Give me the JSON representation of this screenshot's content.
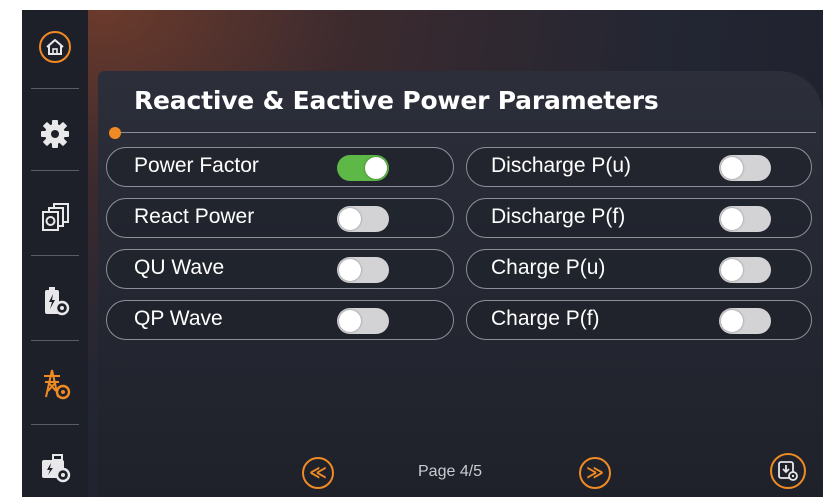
{
  "title": "Reactive & Eactive Power Parameters",
  "colors": {
    "accent": "#f08a24",
    "toggle_on": "#5db847",
    "toggle_off": "#d3d3d6"
  },
  "sidebar": {
    "items": [
      {
        "name": "home",
        "icon": "home-icon",
        "active": false
      },
      {
        "name": "settings",
        "icon": "gear-icon",
        "active": false
      },
      {
        "name": "devices",
        "icon": "device-stack-icon",
        "active": false
      },
      {
        "name": "battery",
        "icon": "battery-settings-icon",
        "active": false
      },
      {
        "name": "grid",
        "icon": "grid-tower-settings-icon",
        "active": true
      },
      {
        "name": "generator",
        "icon": "generator-settings-icon",
        "active": false
      }
    ]
  },
  "left_params": [
    {
      "label": "Power Factor",
      "on": true
    },
    {
      "label": "React Power",
      "on": false
    },
    {
      "label": "QU Wave",
      "on": false
    },
    {
      "label": "QP Wave",
      "on": false
    }
  ],
  "right_params": [
    {
      "label": "Discharge P(u)",
      "on": false
    },
    {
      "label": "Discharge P(f)",
      "on": false
    },
    {
      "label": "Charge P(u)",
      "on": false
    },
    {
      "label": "Charge P(f)",
      "on": false
    }
  ],
  "pager": {
    "prev_glyph": "≪",
    "next_glyph": "≫",
    "page_text": "Page 4/5"
  },
  "save_icon": "save-settings-icon"
}
